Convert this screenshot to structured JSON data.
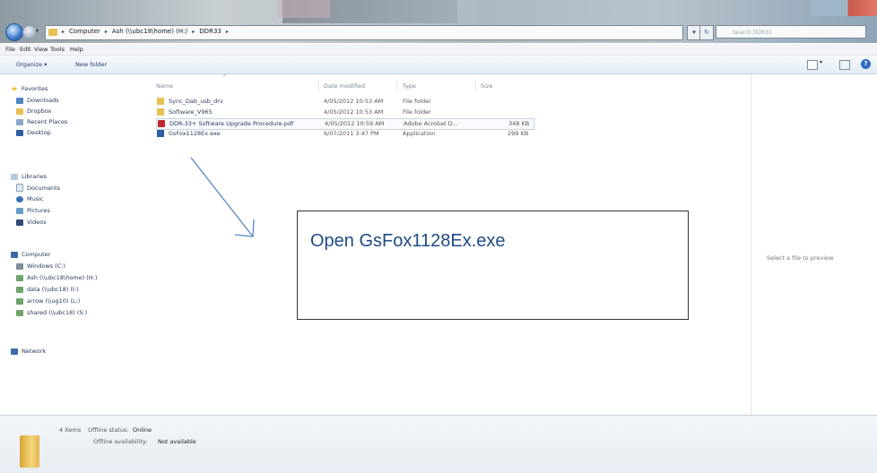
{
  "address": {
    "crumbs": [
      "Computer",
      "Ash (\\\\ubc18\\home) (H:)",
      "DDR33"
    ],
    "search_placeholder": "Search DDR33"
  },
  "menu": [
    "File",
    "Edit",
    "View",
    "Tools",
    "Help"
  ],
  "toolbar": {
    "organize": "Organize ▾",
    "new_folder": "New folder"
  },
  "nav": {
    "favorites": {
      "label": "Favorites",
      "items": [
        "Downloads",
        "Dropbox",
        "Recent Places",
        "Desktop"
      ]
    },
    "libraries": {
      "label": "Libraries",
      "items": [
        "Documents",
        "Music",
        "Pictures",
        "Videos"
      ]
    },
    "computer": {
      "label": "Computer",
      "items": [
        "Windows (C:)",
        "Ash (\\\\ubc18\\home) (H:)",
        "data (\\\\ubc18) (I:)",
        "arrow (\\\\ug10) (L:)",
        "shared (\\\\ubc18) (S:)"
      ]
    },
    "network": {
      "label": "Network"
    }
  },
  "columns": {
    "name": "Name",
    "date": "Date modified",
    "type": "Type",
    "size": "Size"
  },
  "files": [
    {
      "name": "Sync_Dab_usb_drv",
      "date": "4/05/2012 10:53 AM",
      "type": "File folder",
      "size": "",
      "icon": "folder-icon"
    },
    {
      "name": "Software_V965",
      "date": "4/05/2012 10:53 AM",
      "type": "File folder",
      "size": "",
      "icon": "folder-icon"
    },
    {
      "name": "DDR-33+ Software Upgrade Procedure.pdf",
      "date": "4/05/2012 10:59 AM",
      "type": "Adobe Acrobat D...",
      "size": "348 KB",
      "icon": "pdf-icon"
    },
    {
      "name": "GsFox1128Ex.exe",
      "date": "6/07/2011 3:47 PM",
      "type": "Application",
      "size": "299 KB",
      "icon": "exe-icon"
    }
  ],
  "callout": {
    "text": "Open GsFox1128Ex.exe"
  },
  "preview": {
    "text": "Select a file to preview."
  },
  "details": {
    "count": "4 items",
    "offline_status_label": "Offline status:",
    "offline_status_value": "Online",
    "offline_avail_label": "Offline availability:",
    "offline_avail_value": "Not available"
  },
  "colors": {
    "accent": "#1f4b84",
    "folder": "#e8c154",
    "arrow": "#5a87c9"
  }
}
